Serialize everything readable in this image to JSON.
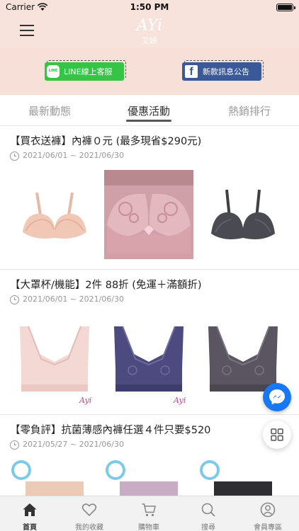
{
  "status_bar": {
    "carrier": "Carrier",
    "time": "1:50 PM"
  },
  "header": {
    "logo_text": "AYi 艾妍",
    "brand_color": "#ffffff"
  },
  "promo_links": {
    "line": {
      "badge": "LINE",
      "label": "LINE線上客服",
      "color": "#34c547"
    },
    "facebook": {
      "label": "新款訊息公告",
      "color": "#3b5998"
    }
  },
  "tabs": [
    {
      "label": "最新動態",
      "active": false
    },
    {
      "label": "優惠活動",
      "active": true
    },
    {
      "label": "熱銷排行",
      "active": false
    }
  ],
  "promotions": [
    {
      "title": "【買衣送褲】內褲０元 (最多現省$290元)",
      "date_range": "2021/06/01 ~ 2021/06/30",
      "products": [
        "nude-bra-image",
        "pink-lace-bra-image",
        "charcoal-bra-image"
      ]
    },
    {
      "title": "【大罩杯/機能】2件 88折 (免運＋滿額折)",
      "date_range": "2021/06/01 ~ 2021/06/30",
      "products": [
        "blush-full-cup-bra-image",
        "navy-full-cup-bra-image",
        "dark-full-cup-bra-image"
      ]
    },
    {
      "title": "【零負評】抗菌薄感內褲任選４件只要$520",
      "date_range": "2021/05/27 ~ 2021/06/30",
      "products": [
        "beige-panty-image",
        "lavender-panty-image",
        "black-panty-image"
      ]
    }
  ],
  "tabbar": [
    {
      "label": "首頁",
      "icon": "home-icon",
      "active": true
    },
    {
      "label": "我的收藏",
      "icon": "heart-icon",
      "active": false
    },
    {
      "label": "購物車",
      "icon": "cart-icon",
      "active": false
    },
    {
      "label": "搜尋",
      "icon": "search-icon",
      "active": false
    },
    {
      "label": "會員專區",
      "icon": "user-icon",
      "active": false
    }
  ]
}
